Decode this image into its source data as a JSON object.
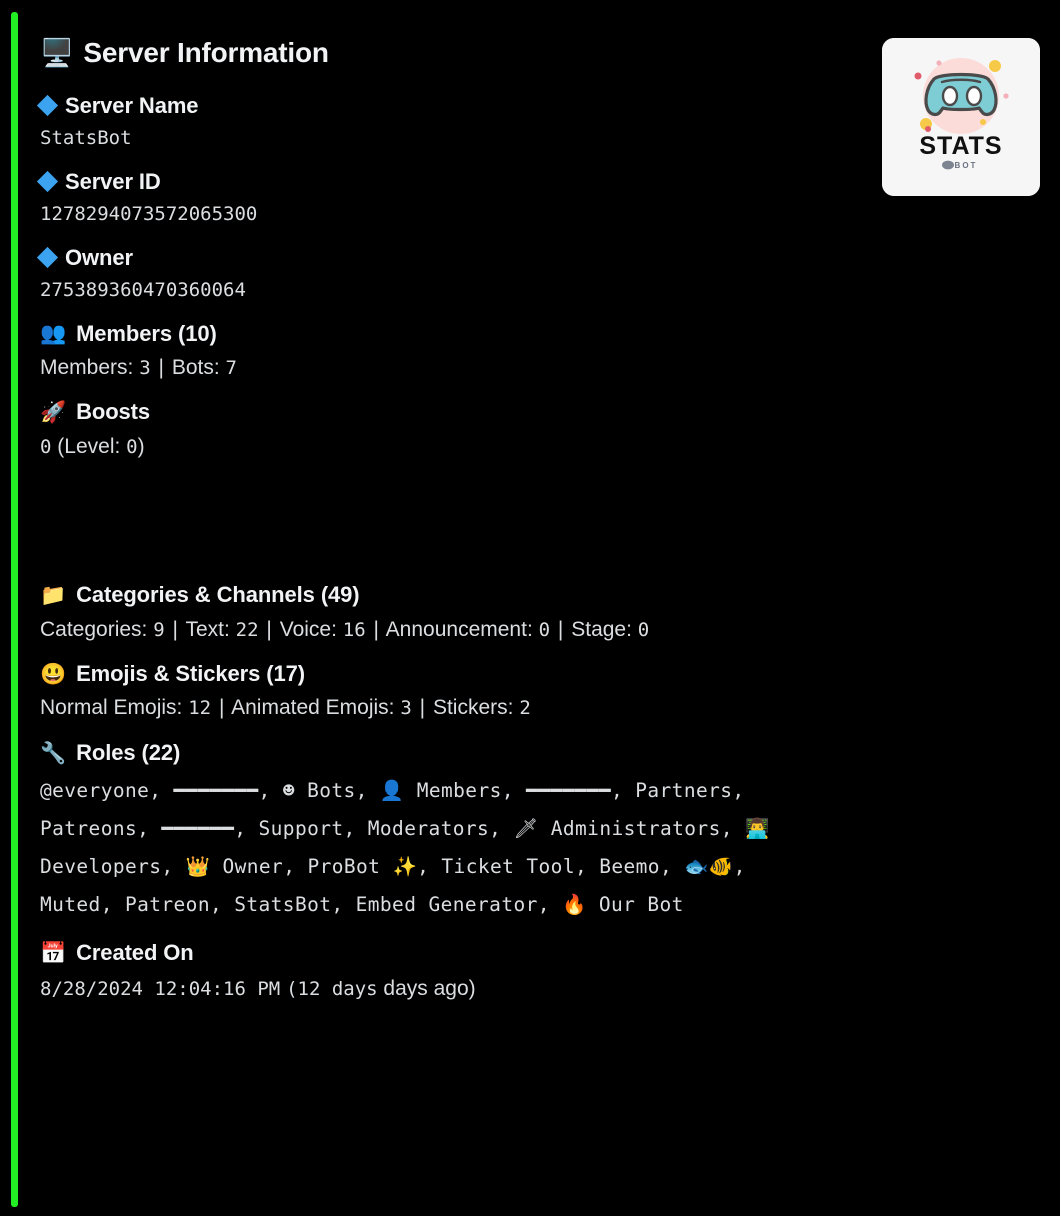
{
  "embed": {
    "accent_color": "#23ee23",
    "title": "Server Information",
    "title_icon": "desktop-computer-emoji",
    "title_emoji": "🖥️",
    "thumbnail": {
      "alt": "STATS BOT logo",
      "label": "STATS",
      "sublabel": "BOT",
      "bg": "#f6f6f7",
      "circle_color": "#fbdcd9",
      "mascot_color": "#7fcdd4"
    },
    "fields": [
      {
        "id": "server-name",
        "icon": "blue-diamond-emoji",
        "emoji": "🔷",
        "name": "Server Name",
        "value": "StatsBot"
      },
      {
        "id": "server-id",
        "icon": "blue-diamond-emoji",
        "emoji": "🔷",
        "name": "Server ID",
        "value": "1278294073572065300"
      },
      {
        "id": "owner",
        "icon": "blue-diamond-emoji",
        "emoji": "🔷",
        "name": "Owner",
        "value": "275389360470360064"
      },
      {
        "id": "members",
        "icon": "busts-in-silhouette-emoji",
        "emoji": "👥",
        "name": "Members (10)",
        "stats": [
          {
            "label": "Members:",
            "value": "3"
          },
          {
            "label": "Bots:",
            "value": "7"
          }
        ]
      },
      {
        "id": "boosts",
        "icon": "rocket-emoji",
        "emoji": "🚀",
        "name": "Boosts",
        "value_mono_1": "0",
        "value_sans": "(Level:",
        "value_mono_2": "0",
        "value_close": ")"
      },
      {
        "id": "categories-channels",
        "icon": "file-folder-emoji",
        "emoji": "📁",
        "name": "Categories & Channels (49)",
        "stats": [
          {
            "label": "Categories:",
            "value": "9"
          },
          {
            "label": "Text:",
            "value": "22"
          },
          {
            "label": "Voice:",
            "value": "16"
          },
          {
            "label": "Announcement:",
            "value": "0"
          },
          {
            "label": "Stage:",
            "value": "0"
          }
        ]
      },
      {
        "id": "emojis-stickers",
        "icon": "grinning-face-emoji",
        "emoji": "😃",
        "name": "Emojis & Stickers (17)",
        "stats": [
          {
            "label": "Normal Emojis:",
            "value": "12"
          },
          {
            "label": "Animated Emojis:",
            "value": "3"
          },
          {
            "label": "Stickers:",
            "value": "2"
          }
        ]
      },
      {
        "id": "roles",
        "icon": "wrench-emoji",
        "emoji": "🔧",
        "name": "Roles (22)",
        "roles_text": "@everyone, ━━━━━━━, ☻ Bots, 👤 Members, ━━━━━━━, Partners, Patreons, ━━━━━━, Support, Moderators, 🗡 Administrators, 👨‍💻 Developers, 👑 Owner, ProBot ✨, Ticket Tool, Beemo, 🐟🐠, Muted, Patreon, StatsBot, Embed Generator, 🔥 Our Bot"
      },
      {
        "id": "created-on",
        "icon": "calendar-emoji",
        "emoji": "📅",
        "name": "Created On",
        "date_mono": "8/28/2024 12:04:16 PM",
        "relative_mono": "(12 days",
        "relative_sans": "days ago)"
      }
    ]
  }
}
